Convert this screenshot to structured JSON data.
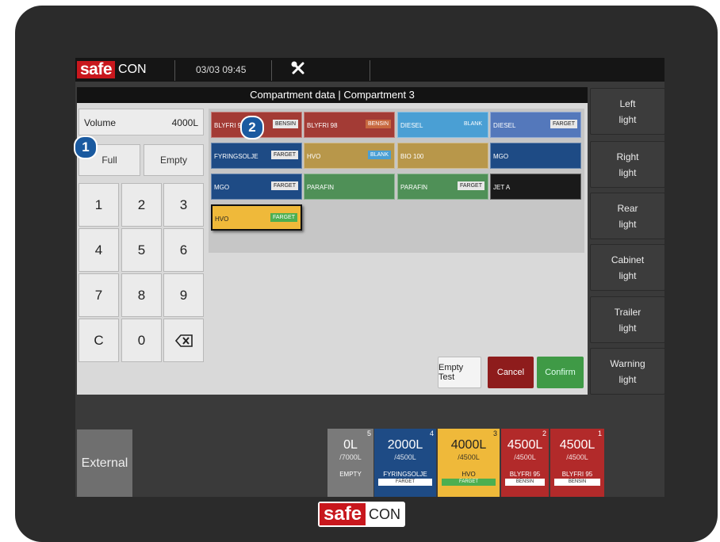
{
  "brand": {
    "safe": "safe",
    "con": "CON"
  },
  "header": {
    "datetime": "03/03 09:45",
    "tools_icon": "wrench-screwdriver-icon"
  },
  "panel": {
    "title": "Compartment data | Compartment 3"
  },
  "volume": {
    "label": "Volume",
    "value": "4000L"
  },
  "quick": {
    "full": "Full",
    "empty": "Empty"
  },
  "keypad": [
    "1",
    "2",
    "3",
    "4",
    "5",
    "6",
    "7",
    "8",
    "9",
    "C",
    "0"
  ],
  "callouts": {
    "one": "1",
    "two": "2"
  },
  "fuels": [
    {
      "name": "BLYFRI 95",
      "tag": "BENSIN",
      "color": "#a33b35",
      "tagcolor": "#e8e8e8",
      "tagtext": "#222"
    },
    {
      "name": "BLYFRI 98",
      "tag": "BENSIN",
      "color": "#a33b35",
      "tagcolor": "#c8683f",
      "tagtext": "#fff"
    },
    {
      "name": "DIESEL",
      "tag": "BLANK",
      "color": "#4a9fd4",
      "tagcolor": "#4a9fd4",
      "tagtext": "#fff"
    },
    {
      "name": "DIESEL",
      "tag": "FARGET",
      "color": "#5478bb",
      "tagcolor": "#e8e8e8",
      "tagtext": "#222"
    },
    {
      "name": "FYRINGSOLJE",
      "tag": "FARGET",
      "color": "#1e4b85",
      "tagcolor": "#e8e8e8",
      "tagtext": "#222"
    },
    {
      "name": "HVO",
      "tag": "BLANK",
      "color": "#b8974a",
      "tagcolor": "#4a9fd4",
      "tagtext": "#fff"
    },
    {
      "name": "BIO 100",
      "tag": "",
      "color": "#b8974a",
      "tagcolor": "",
      "tagtext": ""
    },
    {
      "name": "MGO",
      "tag": "",
      "color": "#1e4b85",
      "tagcolor": "",
      "tagtext": ""
    },
    {
      "name": "MGO",
      "tag": "FARGET",
      "color": "#1e4b85",
      "tagcolor": "#e8e8e8",
      "tagtext": "#222"
    },
    {
      "name": "PARAFIN",
      "tag": "",
      "color": "#4f9057",
      "tagcolor": "",
      "tagtext": ""
    },
    {
      "name": "PARAFIN",
      "tag": "FARGET",
      "color": "#4f9057",
      "tagcolor": "#e8e8e8",
      "tagtext": "#222"
    },
    {
      "name": "JET A",
      "tag": "",
      "color": "#1a1a1a",
      "tagcolor": "",
      "tagtext": ""
    },
    {
      "name": "HVO",
      "tag": "FARGET",
      "color": "#efb93a",
      "tagcolor": "#4caf50",
      "tagtext": "#fff"
    }
  ],
  "actions": {
    "empty_test": "Empty Test",
    "cancel": "Cancel",
    "confirm": "Confirm"
  },
  "lights": [
    {
      "line1": "Left",
      "line2": "light"
    },
    {
      "line1": "Right",
      "line2": "light"
    },
    {
      "line1": "Rear",
      "line2": "light"
    },
    {
      "line1": "Cabinet",
      "line2": "light"
    },
    {
      "line1": "Trailer",
      "line2": "light"
    },
    {
      "line1": "Warning",
      "line2": "light"
    }
  ],
  "external": "External",
  "compartments": [
    {
      "number": "5",
      "volume": "0L",
      "capacity": "/7000L",
      "fuel": "EMPTY",
      "tag": "",
      "color": "#7a7a7a",
      "tagcolor": ""
    },
    {
      "number": "4",
      "volume": "2000L",
      "capacity": "/4500L",
      "fuel": "FYRINGSOLJE",
      "tag": "FARGET",
      "color": "#1e4b85",
      "tagcolor": "#ffffff"
    },
    {
      "number": "3",
      "volume": "4000L",
      "capacity": "/4500L",
      "fuel": "HVO",
      "tag": "FARGET",
      "color": "#efb93a",
      "tagcolor": "#4caf50"
    },
    {
      "number": "2",
      "volume": "4500L",
      "capacity": "/4500L",
      "fuel": "BLYFRI 95",
      "tag": "BENSIN",
      "color": "#b22a2a",
      "tagcolor": "#ffffff"
    },
    {
      "number": "1",
      "volume": "4500L",
      "capacity": "/4500L",
      "fuel": "BLYFRI 95",
      "tag": "BENSIN",
      "color": "#b22a2a",
      "tagcolor": "#ffffff"
    }
  ],
  "footer": {
    "safe": "safe",
    "con": "CON"
  }
}
